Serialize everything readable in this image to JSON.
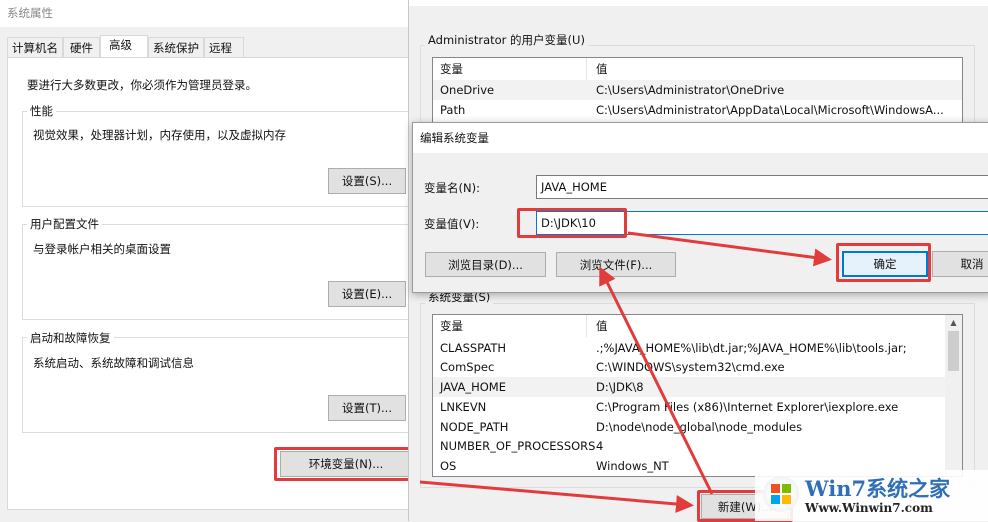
{
  "system_properties": {
    "title": "系统属性",
    "tabs": [
      "计算机名",
      "硬件",
      "高级",
      "系统保护",
      "远程"
    ],
    "active_tab": "高级",
    "admin_note": "要进行大多数更改，你必须作为管理员登录。",
    "groups": [
      {
        "label": "性能",
        "desc": "视觉效果，处理器计划，内存使用，以及虚拟内存",
        "button": "设置(S)..."
      },
      {
        "label": "用户配置文件",
        "desc": "与登录帐户相关的桌面设置",
        "button": "设置(E)..."
      },
      {
        "label": "启动和故障恢复",
        "desc": "系统启动、系统故障和调试信息",
        "button": "设置(T)..."
      }
    ],
    "env_button": "环境变量(N)..."
  },
  "env_vars": {
    "user_group_label": "Administrator 的用户变量(U)",
    "columns": [
      "变量",
      "值"
    ],
    "user_vars": [
      {
        "name": "OneDrive",
        "value": "C:\\Users\\Administrator\\OneDrive"
      },
      {
        "name": "Path",
        "value": "C:\\Users\\Administrator\\AppData\\Local\\Microsoft\\WindowsA..."
      }
    ],
    "system_group_label": "系统变量(S)",
    "system_vars": [
      {
        "name": "CLASSPATH",
        "value": ".;%JAVA_HOME%\\lib\\dt.jar;%JAVA_HOME%\\lib\\tools.jar;"
      },
      {
        "name": "ComSpec",
        "value": "C:\\WINDOWS\\system32\\cmd.exe"
      },
      {
        "name": "JAVA_HOME",
        "value": "D:\\JDK\\8"
      },
      {
        "name": "LNKEVN",
        "value": "C:\\Program Files (x86)\\Internet Explorer\\iexplore.exe"
      },
      {
        "name": "NODE_PATH",
        "value": "D:\\node\\node_global\\node_modules"
      },
      {
        "name": "NUMBER_OF_PROCESSORS",
        "value": "4"
      },
      {
        "name": "OS",
        "value": "Windows_NT"
      }
    ],
    "new_button": "新建(W)..."
  },
  "edit_dialog": {
    "title": "编辑系统变量",
    "name_label": "变量名(N):",
    "name_value": "JAVA_HOME",
    "value_label": "变量值(V):",
    "value_value": "D:\\JDK\\10",
    "browse_dir": "浏览目录(D)...",
    "browse_file": "浏览文件(F)...",
    "ok": "确定",
    "cancel": "取消"
  },
  "watermark": {
    "brand": "Win7系统之家",
    "url": "Www.Winwin7.com"
  },
  "colors": {
    "highlight": "#e23b3b",
    "focus": "#0078d7"
  }
}
